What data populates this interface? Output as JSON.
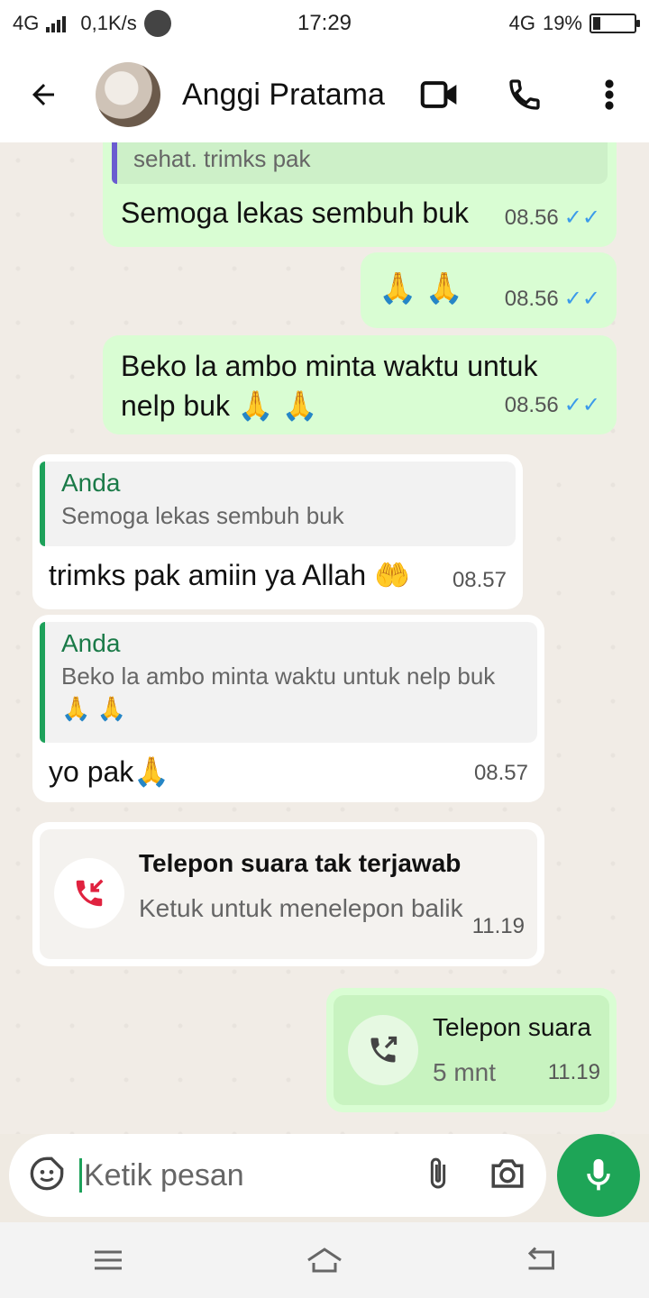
{
  "status_bar": {
    "network": "4G",
    "speed": "0,1K/s",
    "time": "17:29",
    "network_right": "4G",
    "battery": "19%"
  },
  "header": {
    "contact_name": "Anggi Pratama",
    "icons": [
      "back-arrow-icon",
      "video-call-icon",
      "voice-call-icon",
      "more-options-icon"
    ]
  },
  "messages": [
    {
      "id": 1,
      "direction": "out",
      "quote": {
        "text": "sehat. trimks pak"
      },
      "text": "Semoga lekas sembuh buk",
      "time": "08.56"
    },
    {
      "id": 2,
      "direction": "out",
      "text": "🙏 🙏",
      "time": "08.56"
    },
    {
      "id": 3,
      "direction": "out",
      "text": "Beko la ambo minta waktu untuk nelp buk 🙏 🙏",
      "time": "08.56"
    },
    {
      "id": 4,
      "direction": "in",
      "quote": {
        "author": "Anda",
        "text": "Semoga lekas sembuh buk"
      },
      "text": "trimks pak amiin ya Allah 🤲",
      "time": "08.57"
    },
    {
      "id": 5,
      "direction": "in",
      "quote": {
        "author": "Anda",
        "text": "Beko la ambo minta waktu untuk nelp buk 🙏 🙏"
      },
      "text": "yo pak🙏",
      "time": "08.57"
    },
    {
      "id": 6,
      "direction": "in",
      "type": "call",
      "title": "Telepon suara tak terjawab",
      "subtitle": "Ketuk untuk menelepon balik",
      "time": "11.19"
    },
    {
      "id": 7,
      "direction": "out",
      "type": "call",
      "title": "Telepon suara",
      "subtitle": "5 mnt",
      "time": "11.19"
    }
  ],
  "input": {
    "placeholder": "Ketik pesan"
  },
  "colors": {
    "accent_green": "#1ea557",
    "outgoing_bubble": "#d9fdd3",
    "incoming_bubble": "#ffffff",
    "read_ticks": "#3b9aea",
    "missed_call_red": "#e0223f"
  }
}
